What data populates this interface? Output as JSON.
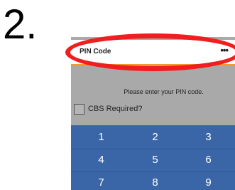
{
  "step_label": "2.",
  "header": {
    "title": "PIN Code",
    "more_icon": "more-horizontal-icon",
    "accent_color": "#f39a2a"
  },
  "prompt": "Please enter your PIN code.",
  "cbs": {
    "label": "CBS Required?",
    "checked": false
  },
  "keypad": {
    "color": "#3a66a8",
    "keys": [
      "1",
      "2",
      "3",
      "4",
      "5",
      "6",
      "7",
      "8",
      "9"
    ]
  },
  "annotation": {
    "highlight_color": "#ef1f1f"
  }
}
